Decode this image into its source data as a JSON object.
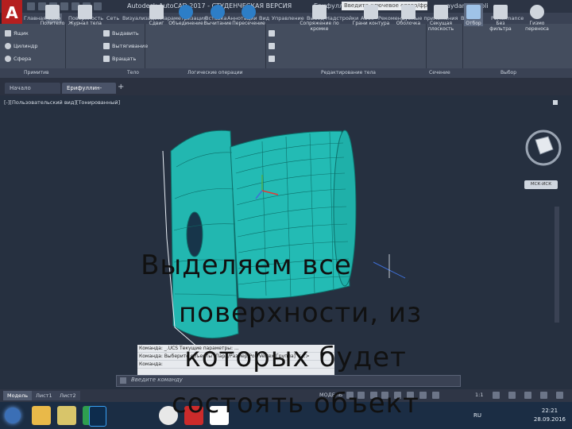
{
  "app": {
    "logo_letter": "A",
    "title": "Autodesk AutoCAD 2017 - СТУДЕНЧЕСКАЯ ВЕРСИЯ",
    "file_name": "Ерифуллин-V1.dwg",
    "search_text": "Введите ключевое слово/фразу",
    "user": "aydan@a.toli"
  },
  "ribbon_tabs": [
    "Главная",
    "Тело",
    "Поверхность",
    "Сеть",
    "Визуализация",
    "Параметризация",
    "Вставка",
    "Аннотации",
    "Вид",
    "Управление",
    "Вывод",
    "Надстройки",
    "A360",
    "Рекомендуемые приложения",
    "BIM 360",
    "Performance"
  ],
  "ribbon_active_tab": "Тело",
  "ribbon": {
    "primitives_small": [
      "Ящик",
      "Цилиндр",
      "Сфера"
    ],
    "big_buttons": [
      "Политело",
      "Журнал тела",
      "Сдвиг",
      "Объединение",
      "Вычитание",
      "Пересечение",
      "Сопряжение по кромке",
      "Грани контура",
      "Оболочка",
      "Секущая плоскость",
      "Отбор",
      "Без фильтра",
      "Гизмо переноса"
    ],
    "body_small": [
      "Выдавить",
      "Вытягивание",
      "Вращать"
    ],
    "panel_titles": [
      "Примитив",
      "Тело",
      "Логические операции",
      "Редактирование тела",
      "Сечение",
      "Выбор"
    ]
  },
  "doc_tabs": [
    "Начало",
    "Ерифуллин-V1*"
  ],
  "doc_tab_add": "+",
  "viewport": {
    "label": "[-][Пользовательский вид][Тонированный]",
    "wcs_label": "МСК-ИСК"
  },
  "command": {
    "history": [
      "Команда: _.UCS Текущие параметры: ...",
      "Команда:  Выберите объекты [Пара/Размер/PolyVertex/Группа] <...>",
      "Команда:"
    ],
    "placeholder": "Введите команду"
  },
  "layout_tabs": [
    "Модель",
    "Лист1",
    "Лист2"
  ],
  "status": {
    "model_label": "МОДЕЛЬ",
    "scale": "1:1"
  },
  "taskbar": {
    "language": "RU",
    "time": "22:21",
    "date": "28.09.2016"
  },
  "overlay_text": {
    "line1": "Выделяем все",
    "line2": "поверхности, из",
    "line3": "которых будет",
    "line4": "состоять объект"
  },
  "colors": {
    "model_fill": "#22b7b0",
    "model_wire": "#0d6f6a",
    "brand_red": "#b51f1f"
  }
}
